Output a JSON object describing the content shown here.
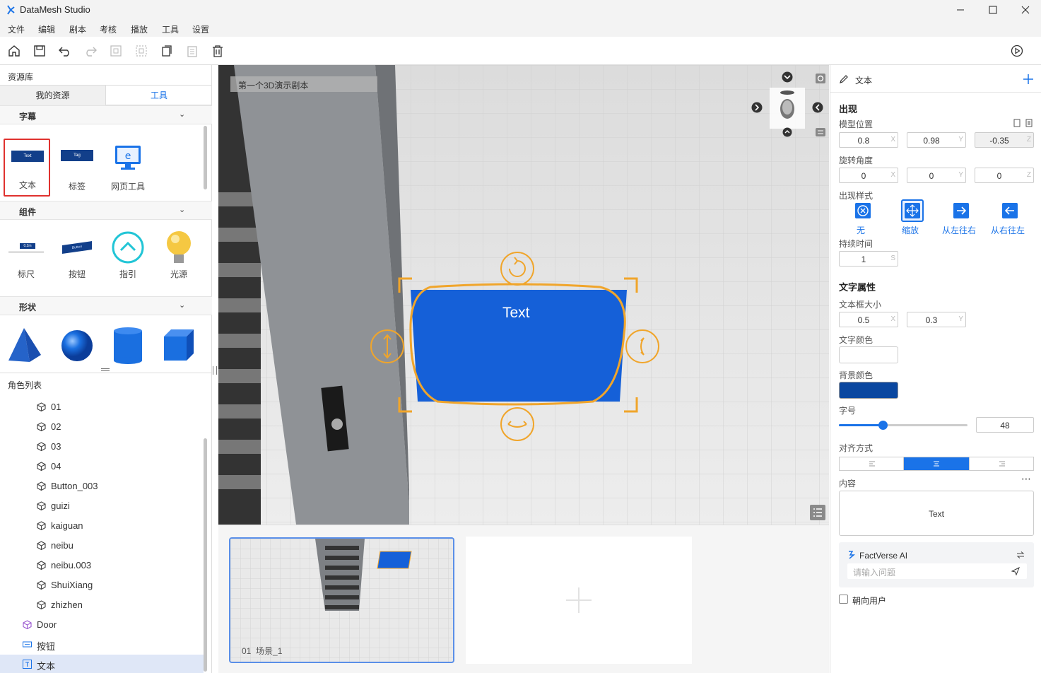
{
  "window": {
    "title": "DataMesh Studio"
  },
  "menu": [
    "文件",
    "编辑",
    "剧本",
    "考核",
    "播放",
    "工具",
    "设置"
  ],
  "left": {
    "library_title": "资源库",
    "tabs": [
      {
        "label": "我的资源",
        "active": false
      },
      {
        "label": "工具",
        "active": true
      }
    ],
    "sections": [
      {
        "label": "字幕",
        "items": [
          {
            "label": "文本",
            "thumb": "Text"
          },
          {
            "label": "标签",
            "thumb": "Tag"
          },
          {
            "label": "网页工具",
            "thumb": ""
          }
        ]
      },
      {
        "label": "组件",
        "items": [
          {
            "label": "标尺",
            "thumb": "0.2m"
          },
          {
            "label": "按钮",
            "thumb": "Button"
          },
          {
            "label": "指引",
            "thumb": ""
          },
          {
            "label": "光源",
            "thumb": ""
          }
        ]
      },
      {
        "label": "形状",
        "items": [
          "pyramid",
          "sphere",
          "cylinder",
          "cube"
        ]
      }
    ],
    "roles_title": "角色列表",
    "roles": [
      {
        "name": "01",
        "icon": "cube-outline-icon"
      },
      {
        "name": "02",
        "icon": "cube-outline-icon"
      },
      {
        "name": "03",
        "icon": "cube-outline-icon"
      },
      {
        "name": "04",
        "icon": "cube-outline-icon"
      },
      {
        "name": "Button_003",
        "icon": "cube-outline-icon"
      },
      {
        "name": "guizi",
        "icon": "cube-outline-icon"
      },
      {
        "name": "kaiguan",
        "icon": "cube-outline-icon"
      },
      {
        "name": "neibu",
        "icon": "cube-outline-icon"
      },
      {
        "name": "neibu.003",
        "icon": "cube-outline-icon"
      },
      {
        "name": "ShuiXiang",
        "icon": "cube-outline-icon"
      },
      {
        "name": "zhizhen",
        "icon": "cube-outline-icon"
      },
      {
        "name": "Door",
        "icon": "purple-cube-icon"
      },
      {
        "name": "按钮",
        "icon": "button-icon"
      },
      {
        "name": "文本",
        "icon": "text-icon",
        "selected": true
      }
    ]
  },
  "viewport": {
    "script_name": "第一个3D演示剧本",
    "text_object": "Text"
  },
  "strip": {
    "scenes": [
      {
        "label": "01  场景_1",
        "selected": true
      }
    ]
  },
  "right": {
    "header": "文本",
    "appear_title": "出现",
    "model_position": {
      "label": "模型位置",
      "x": "0.8",
      "y": "0.98",
      "z": "-0.35"
    },
    "rotation": {
      "label": "旋转角度",
      "x": "0",
      "y": "0",
      "z": "0"
    },
    "appear_style": {
      "label": "出现样式",
      "options": [
        "无",
        "缩放",
        "从左往右",
        "从右往左"
      ],
      "selected": "缩放"
    },
    "duration": {
      "label": "持续时间",
      "value": "1",
      "unit": "S"
    },
    "text_props_title": "文字属性",
    "box_size": {
      "label": "文本框大小",
      "x": "0.5",
      "y": "0.3"
    },
    "text_color_label": "文字颜色",
    "bg_color_label": "背景颜色",
    "bg_color": "#0a47a0",
    "font_size": {
      "label": "字号",
      "value": "48",
      "fraction": 0.34
    },
    "align": {
      "label": "对齐方式",
      "selected": "center"
    },
    "content": {
      "label": "内容",
      "value": "Text"
    },
    "ai": {
      "title": "FactVerse AI",
      "placeholder": "请输入问题"
    },
    "face_user": {
      "label": "朝向用户",
      "checked": false
    }
  },
  "axes": {
    "x": "X",
    "y": "Y",
    "z": "Z"
  }
}
